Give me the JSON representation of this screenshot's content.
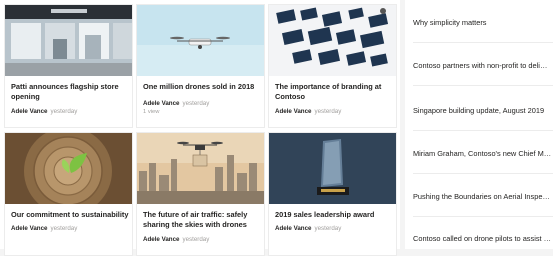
{
  "news": [
    {
      "title": "Patti announces flagship store opening",
      "author": "Adele Vance",
      "time": "yesterday",
      "image": "storefront-photo"
    },
    {
      "title": "One million drones sold in 2018",
      "author": "Adele Vance",
      "time": "yesterday",
      "views": "1 view",
      "image": "drone-photo"
    },
    {
      "title": "The importance of branding at Contoso",
      "author": "Adele Vance",
      "time": "yesterday",
      "image": "branding-screens-photo"
    },
    {
      "title": "Our commitment to sustainability",
      "author": "Adele Vance",
      "time": "yesterday",
      "image": "seedling-stump-photo"
    },
    {
      "title": "The future of air traffic: safely sharing the skies with drones",
      "author": "Adele Vance",
      "time": "yesterday",
      "image": "drone-city-photo"
    },
    {
      "title": "2019 sales leadership award",
      "author": "Adele Vance",
      "time": "yesterday",
      "image": "award-trophy-photo"
    }
  ],
  "side_list": [
    "Why simplicity matters",
    "Contoso partners with non-profit to deli…",
    "Singapore building update, August 2019",
    "Miriam Graham, Contoso's new Chief Ma…",
    "Pushing the Boundaries on Aerial Inspec…",
    "Contoso called on drone pilots to assist f…"
  ]
}
